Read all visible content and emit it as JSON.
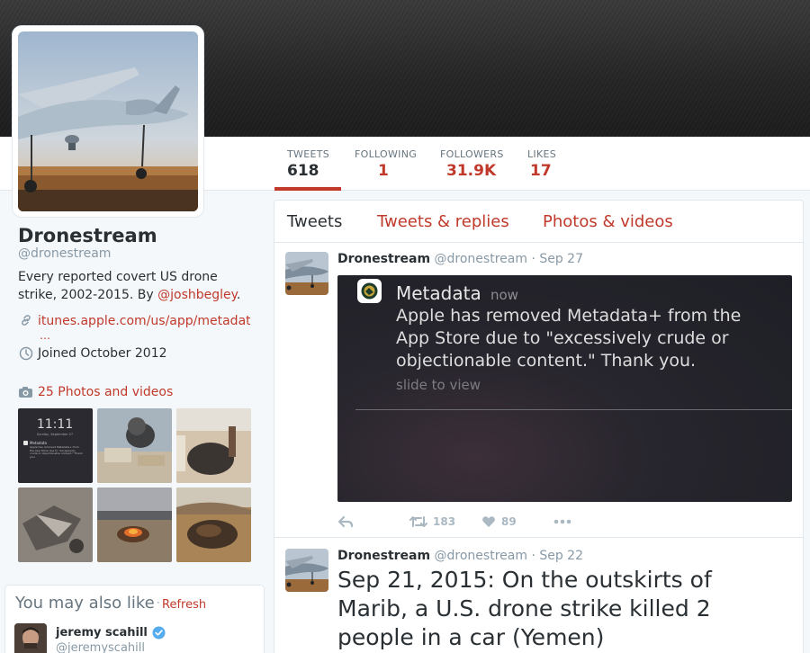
{
  "profile": {
    "name": "Dronestream",
    "handle": "@dronestream",
    "bio_text": "Every reported covert US drone strike, 2002-2015. By ",
    "bio_link": "@joshbegley",
    "bio_end": ".",
    "website": "itunes.apple.com/us/app/metadat",
    "website_more": "…",
    "joined": "Joined October 2012",
    "photos_label": "25 Photos and videos"
  },
  "stats": [
    {
      "label": "TWEETS",
      "value": "618"
    },
    {
      "label": "FOLLOWING",
      "value": "1"
    },
    {
      "label": "FOLLOWERS",
      "value": "31.9K"
    },
    {
      "label": "LIKES",
      "value": "17"
    }
  ],
  "tabs": [
    "Tweets",
    "Tweets & replies",
    "Photos & videos"
  ],
  "thumbs": [
    {
      "kind": "phone",
      "time": "11:11",
      "date": "Sunday, September 27",
      "app": "Metadata",
      "text": "Apple has removed Metadata+ from the App Store due to \"excessively crude or objectionable content.\" Thank you."
    },
    {
      "kind": "smoke"
    },
    {
      "kind": "wreck"
    },
    {
      "kind": "debris"
    },
    {
      "kind": "fire"
    },
    {
      "kind": "burned"
    }
  ],
  "who_to_follow": {
    "title": "You may also like",
    "separator": "·",
    "refresh": "Refresh",
    "users": [
      {
        "name": "jeremy scahill",
        "handle": "@jeremyscahill"
      }
    ]
  },
  "tweets": [
    {
      "name": "Dronestream",
      "handle": "@dronestream",
      "date": "· Sep 27",
      "notification": {
        "app": "Metadata",
        "time": "now",
        "body": "Apple has removed Metadata+ from the App Store due to \"excessively crude or objectionable content.\" Thank you.",
        "hint": "slide to view"
      },
      "retweets": "183",
      "likes": "89"
    },
    {
      "name": "Dronestream",
      "handle": "@dronestream",
      "date": "· Sep 22",
      "text": "Sep 21, 2015: On the outskirts of Marib, a U.S. drone strike killed 2 people in a car (Yemen)"
    }
  ],
  "colors": {
    "accent": "#c0392b",
    "text": "#292f33",
    "muted": "#8899a6",
    "border": "#e1e8ed"
  }
}
